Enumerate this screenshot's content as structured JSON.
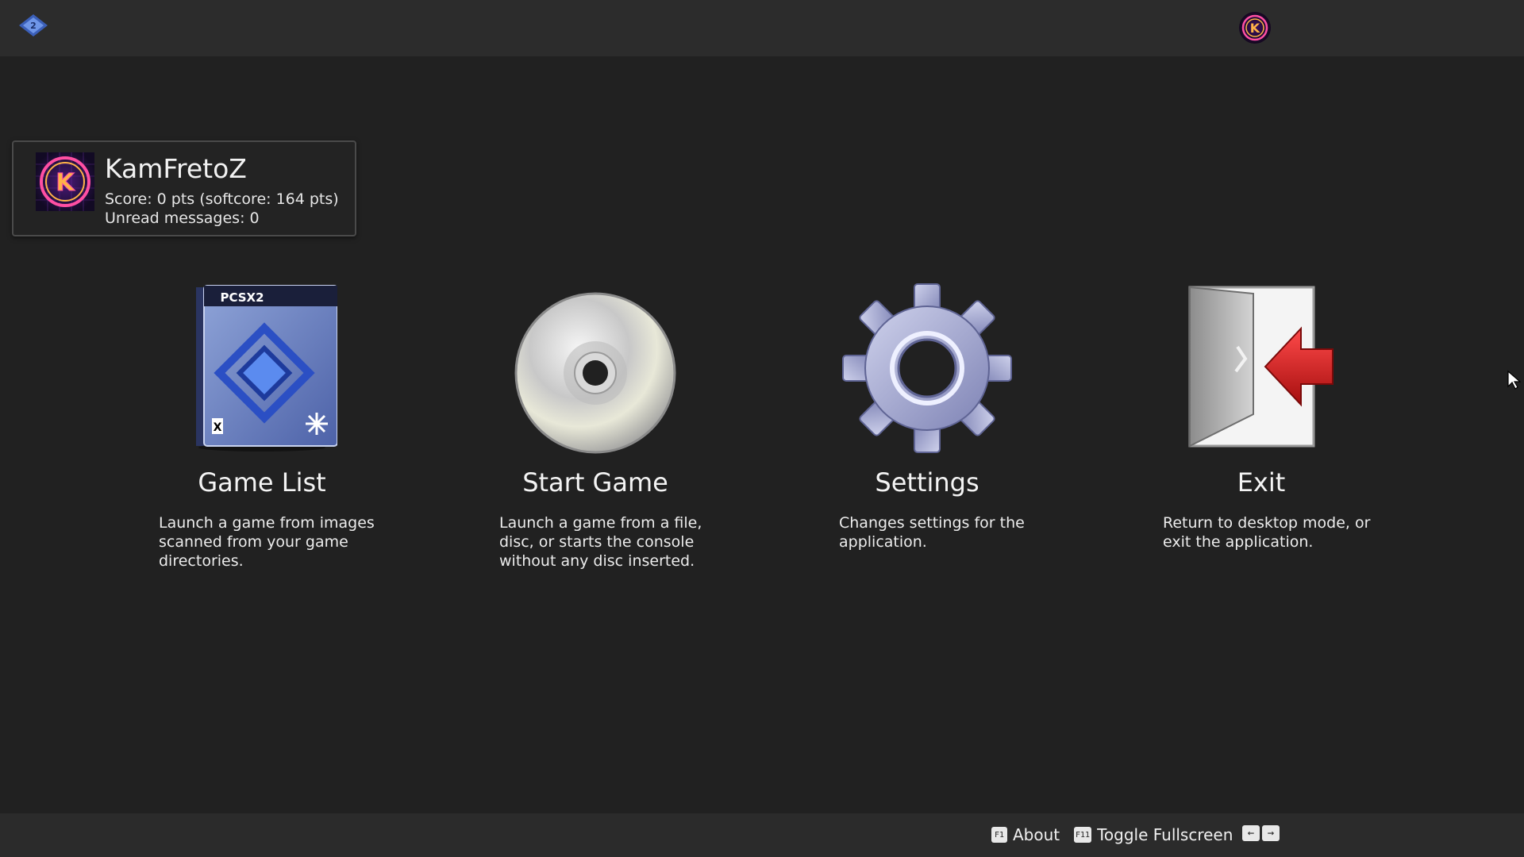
{
  "colors": {
    "background": "#212121",
    "topbar": "#2c2c2c",
    "bottombar": "#2b2b2b",
    "card_border": "#4a4a4a",
    "text": "#f4f4f4",
    "exit_arrow": "#d01d1d"
  },
  "header": {
    "logo_icon": "pcsx2-logo-icon",
    "avatar_icon": "user-avatar-icon"
  },
  "user": {
    "name": "KamFretoZ",
    "score": "Score: 0 pts (softcore: 164 pts)",
    "unread": "Unread messages: 0",
    "avatar_letter": "K"
  },
  "menu": [
    {
      "title": "Game List",
      "description": "Launch a game from images scanned from your game directories.",
      "icon": "game-case-icon",
      "cover_text": "PCSX2"
    },
    {
      "title": "Start Game",
      "description": "Launch a game from a file, disc, or starts the console without any disc inserted.",
      "icon": "disc-icon"
    },
    {
      "title": "Settings",
      "description": "Changes settings for the application.",
      "icon": "gear-icon"
    },
    {
      "title": "Exit",
      "description": "Return to desktop mode, or exit the application.",
      "icon": "exit-door-icon"
    }
  ],
  "footer": {
    "about_key": "F1",
    "about_label": "About",
    "fullscreen_key": "F11",
    "fullscreen_label": "Toggle Fullscreen",
    "nav_left": "←",
    "nav_right": "→"
  }
}
